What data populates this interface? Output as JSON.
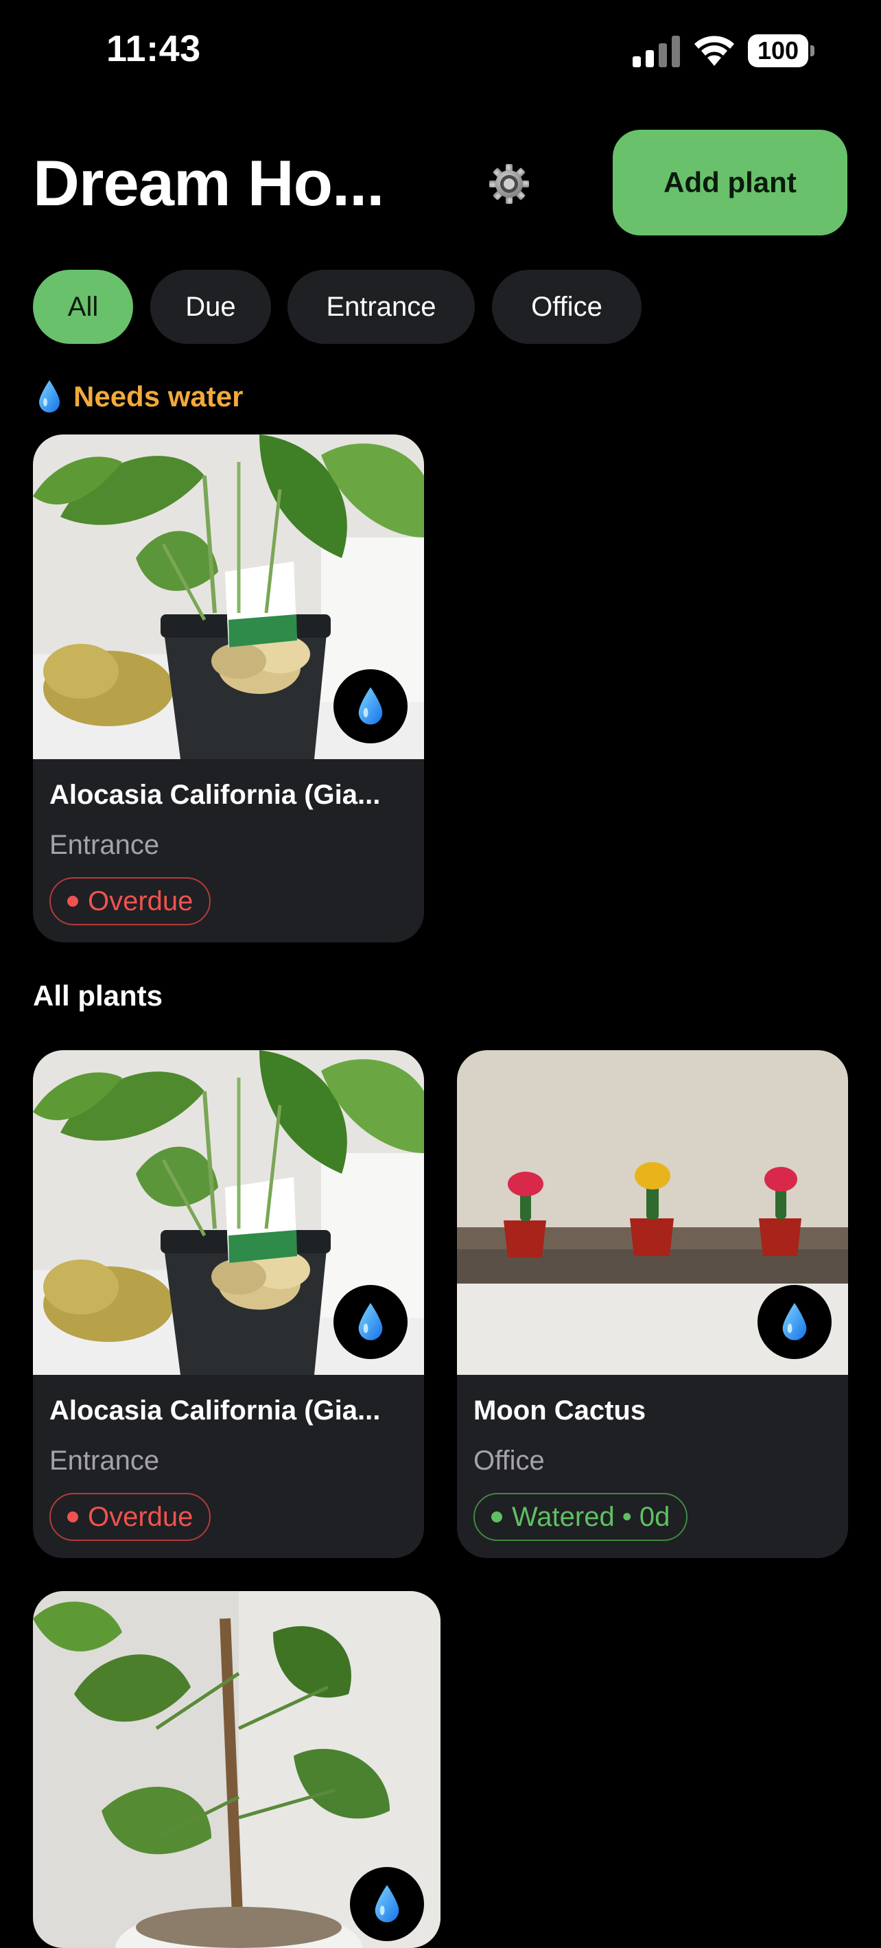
{
  "status_bar": {
    "time": "11:43",
    "battery": "100",
    "icons": [
      "cellular-signal-icon",
      "wifi-icon",
      "battery-icon"
    ]
  },
  "header": {
    "title": "Dream Ho...",
    "settings_icon": "gear-icon",
    "add_button_label": "Add plant"
  },
  "filters": {
    "chips": [
      {
        "label": "All",
        "active": true
      },
      {
        "label": "Due",
        "active": false
      },
      {
        "label": "Entrance",
        "active": false
      },
      {
        "label": "Office",
        "active": false
      }
    ]
  },
  "needs_water": {
    "icon": "water-drop-icon",
    "title": "Needs water",
    "cards": [
      {
        "name": "Alocasia California (Gia...",
        "room": "Entrance",
        "status": "Overdue",
        "status_type": "overdue",
        "action_icon": "water-drop-icon"
      }
    ]
  },
  "all_plants": {
    "title": "All plants",
    "cards": [
      {
        "name": "Alocasia California (Gia...",
        "room": "Entrance",
        "status": "Overdue",
        "status_type": "overdue",
        "action_icon": "water-drop-icon"
      },
      {
        "name": "Moon Cactus",
        "room": "Office",
        "status": "Watered • 0d",
        "status_type": "watered",
        "action_icon": "water-drop-icon"
      },
      {
        "name": "",
        "room": "",
        "status": "",
        "action_icon": "water-drop-icon"
      }
    ]
  },
  "colors": {
    "accent_green": "#69c16b",
    "warning_orange": "#f2aa3a",
    "overdue_red": "#f0524f",
    "watered_green": "#5fc063",
    "card_bg": "#1f2023",
    "background": "#000000"
  }
}
